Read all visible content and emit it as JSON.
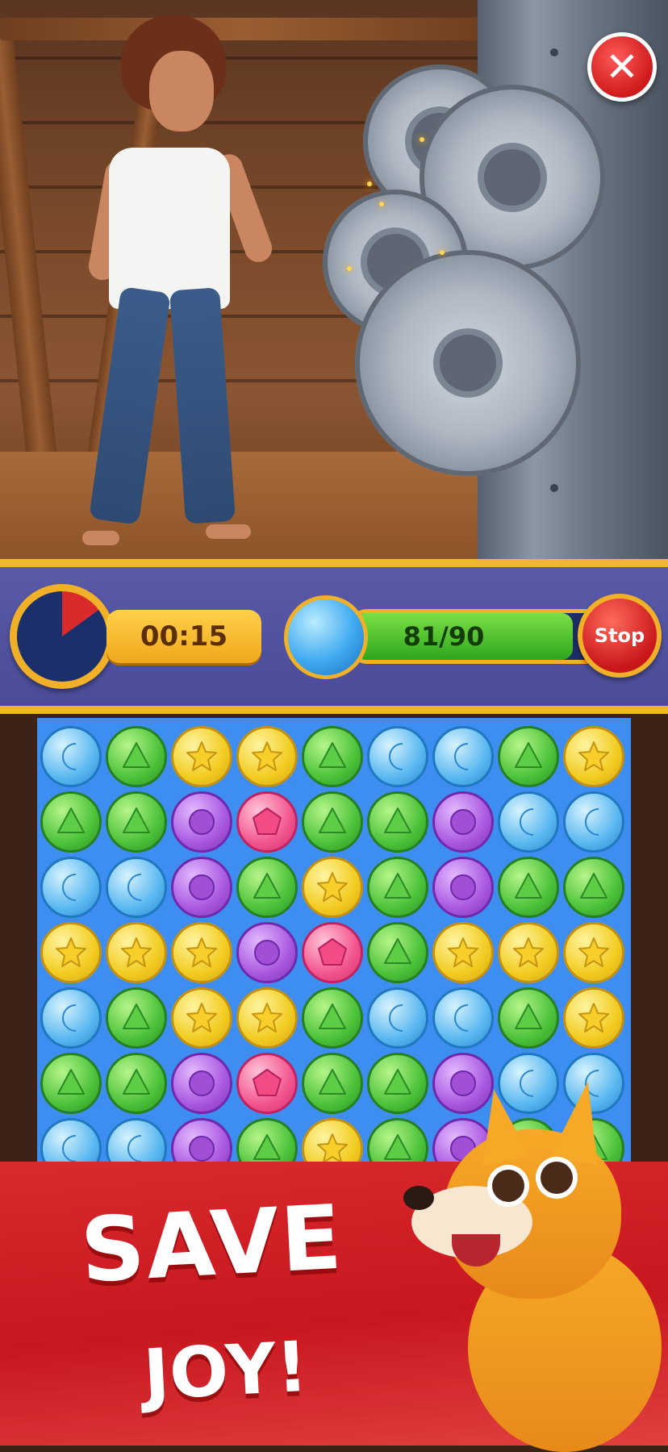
{
  "window": {
    "close_icon": "close-icon"
  },
  "hud": {
    "timer": {
      "value": "00:15",
      "elapsed_fraction": 0.15,
      "icon": "clock-icon"
    },
    "goal": {
      "icon": "moon-bubble-icon",
      "text": "81/90",
      "current": 81,
      "target": 90
    },
    "stop_label": "Stop"
  },
  "board": {
    "rows": [
      [
        "moon",
        "tri",
        "star",
        "star",
        "tri",
        "moon",
        "moon",
        "tri",
        "star"
      ],
      [
        "tri",
        "tri",
        "circle",
        "pent",
        "tri",
        "tri",
        "circle",
        "moon",
        "moon"
      ],
      [
        "moon",
        "moon",
        "circle",
        "tri",
        "star",
        "tri",
        "circle",
        "tri",
        "tri"
      ],
      [
        "star",
        "star",
        "star",
        "circle",
        "pent",
        "tri",
        "star",
        "star",
        "star"
      ],
      [
        "moon",
        "tri",
        "star",
        "star",
        "tri",
        "moon",
        "moon",
        "tri",
        "star"
      ],
      [
        "tri",
        "tri",
        "circle",
        "pent",
        "tri",
        "tri",
        "circle",
        "moon",
        "moon"
      ],
      [
        "moon",
        "moon",
        "circle",
        "tri",
        "star",
        "tri",
        "circle",
        "tri",
        "tri"
      ]
    ]
  },
  "banner": {
    "line1": "SAVE",
    "line2": "JOY!"
  },
  "colors": {
    "accent": "#f0b027",
    "banner": "#d92a2e",
    "board": "#3e8df0",
    "hud": "#4a4c98"
  }
}
